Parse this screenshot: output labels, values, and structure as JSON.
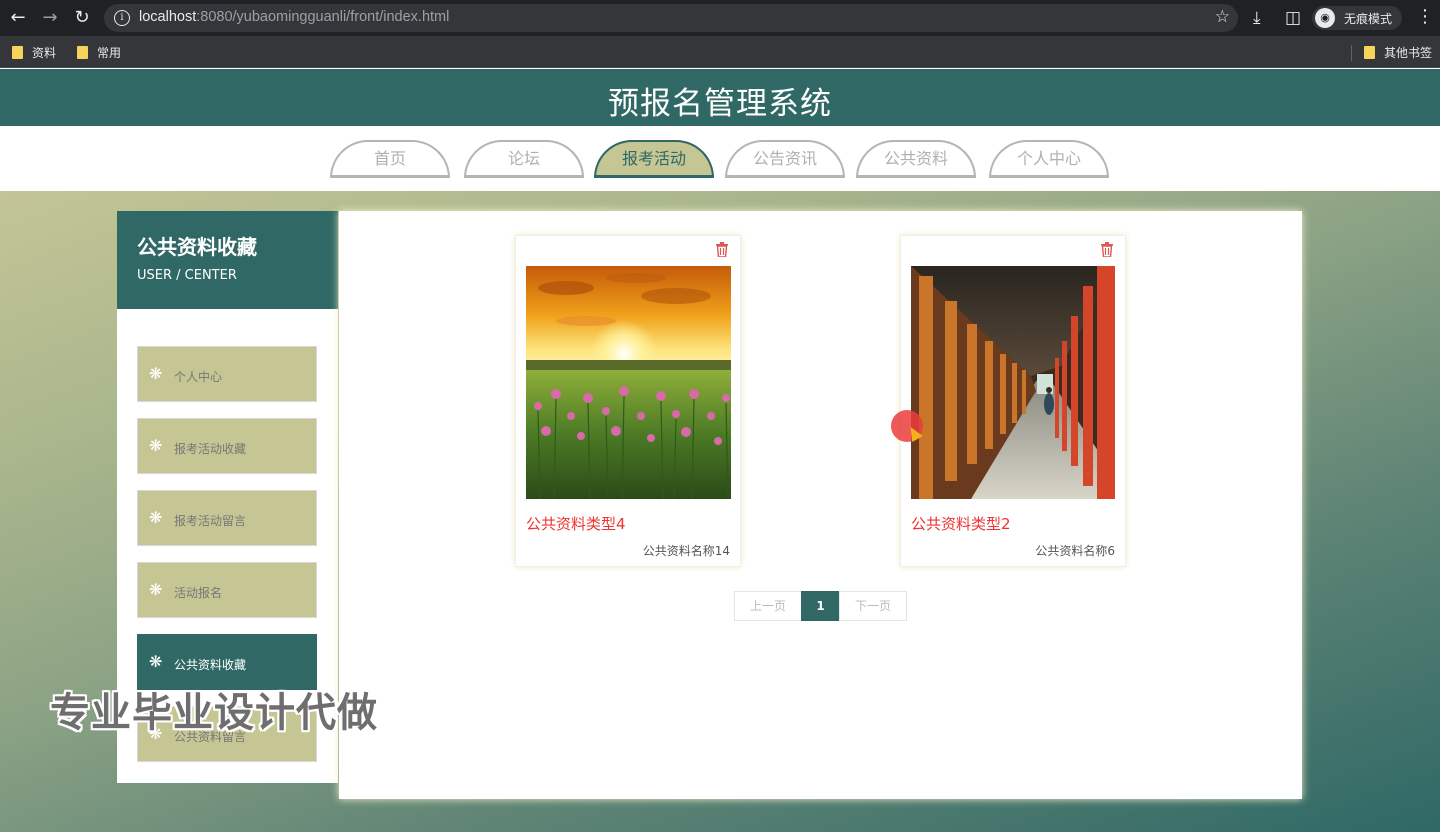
{
  "browser": {
    "url_host": "localhost",
    "url_rest": ":8080/yubaomingguanli/front/index.html",
    "incognito_label": "无痕模式",
    "bookmarks": [
      "资料",
      "常用"
    ],
    "other_bookmarks": "其他书签"
  },
  "header": {
    "title": "预报名管理系统"
  },
  "nav": {
    "tabs": [
      "首页",
      "论坛",
      "报考活动",
      "公告资讯",
      "公共资料",
      "个人中心"
    ],
    "active": "报考活动"
  },
  "sidebar": {
    "title": "公共资料收藏",
    "subtitle": "USER / CENTER",
    "items": [
      "个人中心",
      "报考活动收藏",
      "报考活动留言",
      "活动报名",
      "公共资料收藏",
      "公共资料留言"
    ],
    "active": "公共资料收藏",
    "item_icon": "snowflake-icon"
  },
  "cards": [
    {
      "category": "公共资料类型4",
      "name": "公共资料名称14",
      "image": "sunset-flower-field"
    },
    {
      "category": "公共资料类型2",
      "name": "公共资料名称6",
      "image": "red-pillar-corridor"
    }
  ],
  "pagination": {
    "prev": "上一页",
    "current": "1",
    "next": "下一页"
  },
  "watermark": "专业毕业设计代做",
  "colors": {
    "primary": "#2f6865",
    "accent": "#c5c694",
    "highlight": "#e33333"
  }
}
